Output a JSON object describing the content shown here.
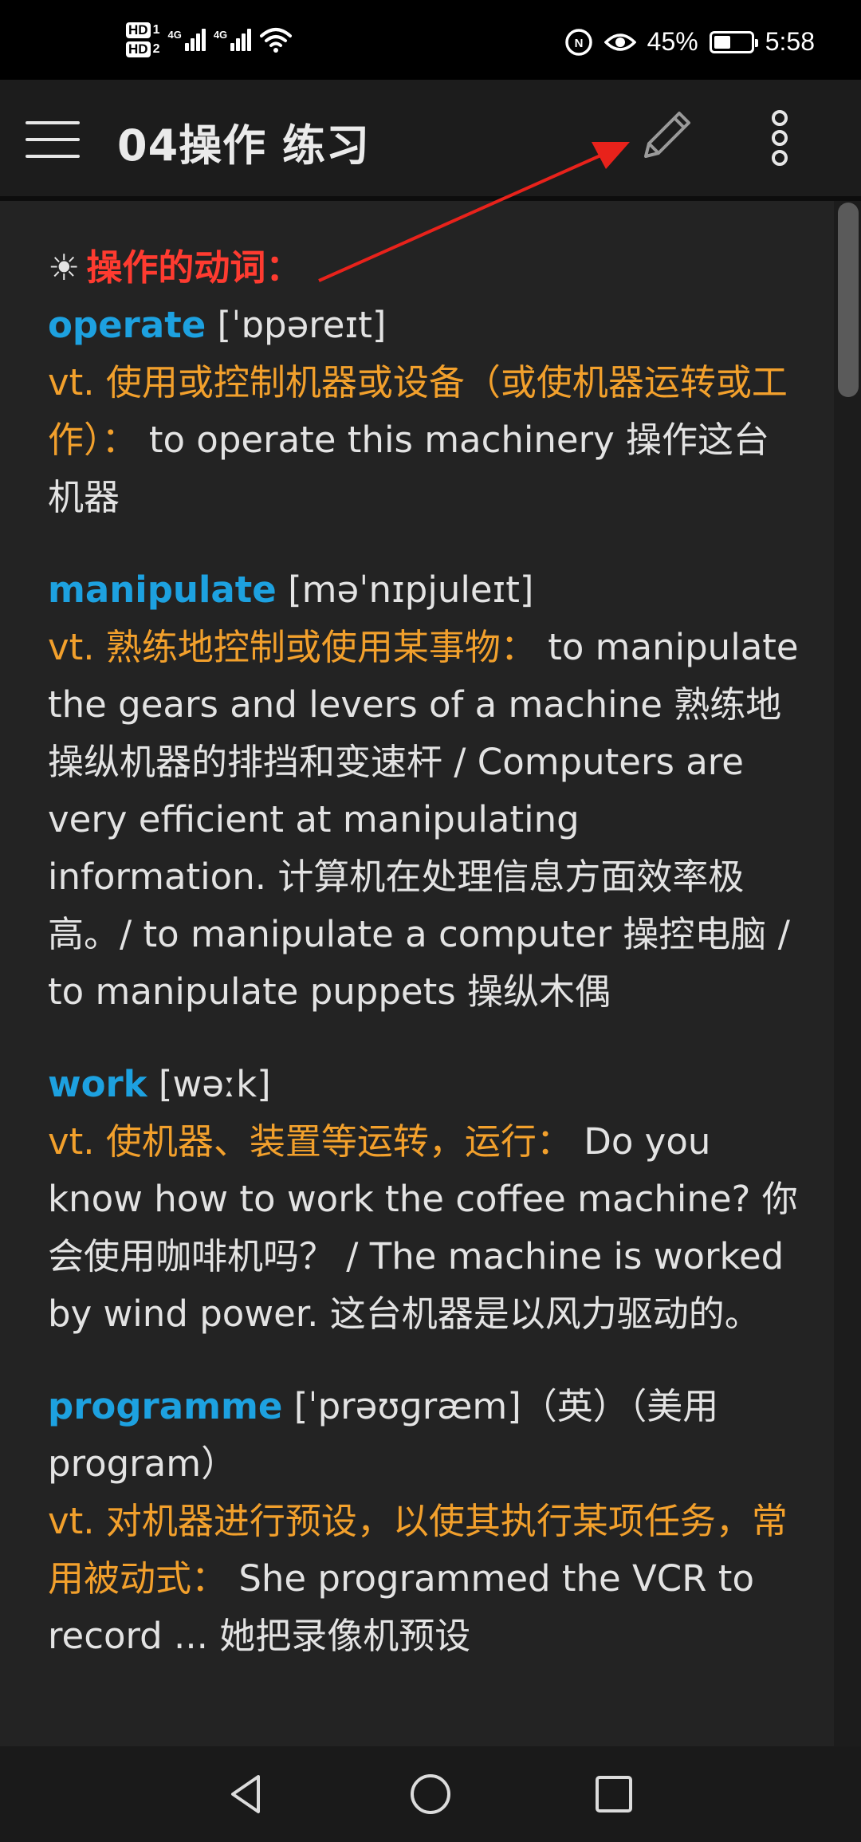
{
  "status_bar": {
    "hd1": "HD",
    "sim1": "1",
    "hd2": "HD",
    "sim2": "2",
    "net1": "4G",
    "net2": "4G",
    "battery_text": "45%",
    "battery_level": 0.45,
    "time": "5:58",
    "icons": [
      "signal-icon",
      "signal-icon",
      "wifi-icon",
      "nfc-icon",
      "eye-icon",
      "battery-icon"
    ]
  },
  "app_bar": {
    "title": "04操作 练习",
    "menu_icon": "hamburger-menu-icon",
    "edit_icon": "pencil-icon",
    "more_icon": "more-vertical-icon"
  },
  "content": {
    "heading_symbol": "☀",
    "heading": "操作的动词：",
    "entries": [
      {
        "word": "operate",
        "pron": " [ˈɒpəreɪt]",
        "def": "vt. 使用或控制机器或设备（或使机器运转或工作）：",
        "example": " to operate this machinery 操作这台机器"
      },
      {
        "word": "manipulate",
        "pron": " [məˈnɪpjuleɪt]",
        "def": "vt. 熟练地控制或使用某事物：",
        "example": " to manipulate the gears and levers of a machine 熟练地操纵机器的排挡和变速杆 / Computers are very efficient at manipulating information. 计算机在处理信息方面效率极高。/ to manipulate a computer 操控电脑 / to manipulate puppets 操纵木偶"
      },
      {
        "word": "work",
        "pron": " [wəːk]",
        "def": "vt. 使机器、装置等运转，运行：",
        "example": " Do you know how to work the coffee machine? 你会使用咖啡机吗？ / The machine is worked by wind power. 这台机器是以风力驱动的。"
      },
      {
        "word": "programme",
        "pron": " [ˈprəʊɡræm]（英）（美用 program）",
        "def": "vt. 对机器进行预设，以使其执行某项任务，常用被动式：",
        "example": " She programmed the VCR to record ... 她把录像机预设"
      }
    ]
  },
  "nav_bar": {
    "back_icon": "back-triangle-icon",
    "home_icon": "home-circle-icon",
    "recents_icon": "recents-square-icon"
  },
  "colors": {
    "background": "#232323",
    "heading": "#ff3b30",
    "word": "#1da1e0",
    "definition": "#f2a02c",
    "text": "#e3e3e3",
    "annotation_arrow": "#e8221b"
  }
}
